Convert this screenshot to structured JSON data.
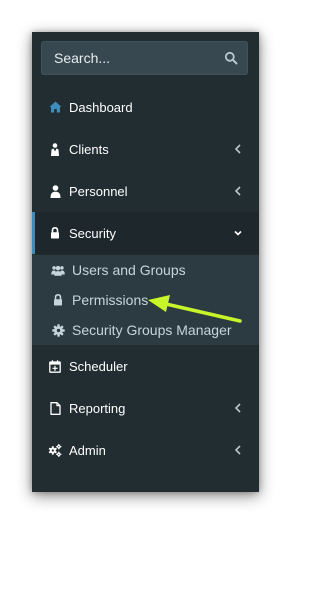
{
  "search": {
    "placeholder": "Search..."
  },
  "menu": {
    "dashboard": "Dashboard",
    "clients": "Clients",
    "personnel": "Personnel",
    "security": "Security",
    "scheduler": "Scheduler",
    "reporting": "Reporting",
    "admin": "Admin"
  },
  "submenu": {
    "users_groups": "Users and Groups",
    "permissions": "Permissions",
    "security_groups_manager": "Security Groups Manager"
  },
  "colors": {
    "sidebar_bg": "#222d32",
    "active_bg": "#1e282c",
    "submenu_bg": "#2c3b41",
    "accent": "#3c8dbc",
    "annotation_arrow": "#c7f52a"
  }
}
